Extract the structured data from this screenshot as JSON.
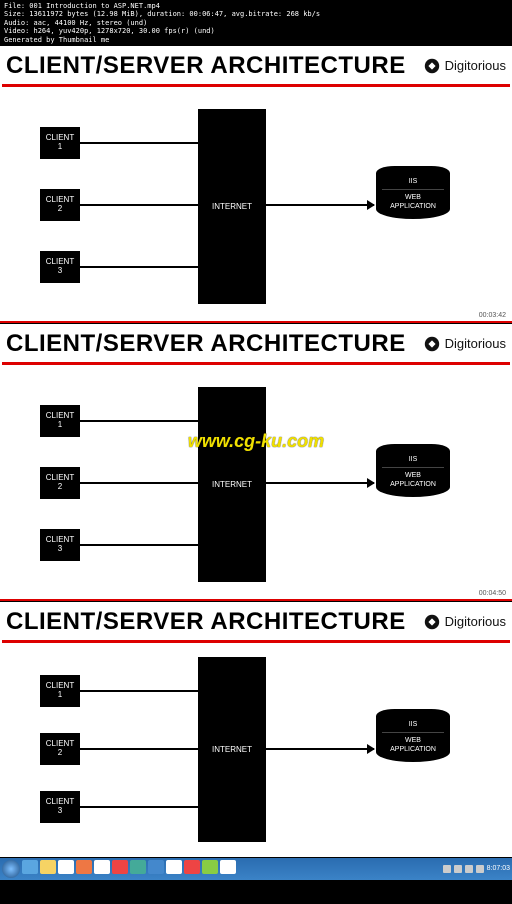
{
  "meta": {
    "line1": "File: 001 Introduction to ASP.NET.mp4",
    "line2": "Size: 13611972 bytes (12.98 MiB), duration: 00:06:47, avg.bitrate: 268 kb/s",
    "line3": "Audio: aac, 44100 Hz, stereo (und)",
    "line4": "Video: h264, yuv420p, 1278x720, 30.00 fps(r) (und)",
    "line5": "Generated by Thumbnail me"
  },
  "slide_title": "CLIENT/SERVER ARCHITECTURE",
  "brand": "Digitorious",
  "client_label": "CLIENT",
  "clients": {
    "one": "1",
    "two": "2",
    "three": "3"
  },
  "internet": "INTERNET",
  "server": {
    "iis": "IIS",
    "web": "WEB",
    "app": "APPLICATION"
  },
  "timestamps": {
    "s1": "00:03:42",
    "s2": "00:04:50"
  },
  "watermark": "www.cg-ku.com",
  "taskbar": {
    "time": "8:07:03"
  }
}
